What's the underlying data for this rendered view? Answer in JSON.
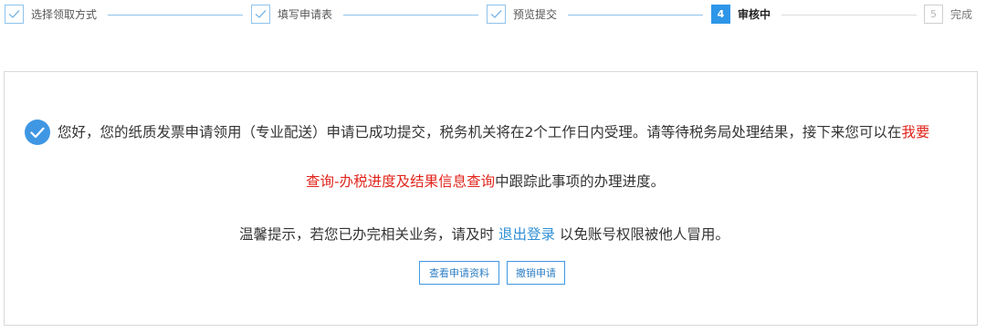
{
  "steps": [
    {
      "label": "选择领取方式",
      "status": "done",
      "icon": "check-icon"
    },
    {
      "label": "填写申请表",
      "status": "done",
      "icon": "check-icon"
    },
    {
      "label": "预览提交",
      "status": "done",
      "icon": "check-icon"
    },
    {
      "number": "4",
      "label": "审核中",
      "status": "current"
    },
    {
      "number": "5",
      "label": "完成",
      "status": "todo"
    }
  ],
  "result": {
    "icon": "check-circle-icon",
    "line1_text": "您好，您的纸质发票申请领用（专业配送）申请已成功提交，税务机关将在2个工作日内受理。请等待税务局处理结果，接下来您可以在",
    "line1_highlight": "我要",
    "line2_highlight": "查询-办税进度及结果信息查询",
    "line2_text": "中跟踪此事项的办理进度。",
    "tip_prefix": "温馨提示，若您已办完相关业务，请及时 ",
    "tip_link": "退出登录",
    "tip_suffix": " 以免账号权限被他人冒用。"
  },
  "buttons": {
    "view_label": "查看申请资料",
    "cancel_label": "撤销申请"
  },
  "colors": {
    "accent": "#2e96e8",
    "highlight": "#e0261d",
    "link": "#2e8fd5"
  }
}
